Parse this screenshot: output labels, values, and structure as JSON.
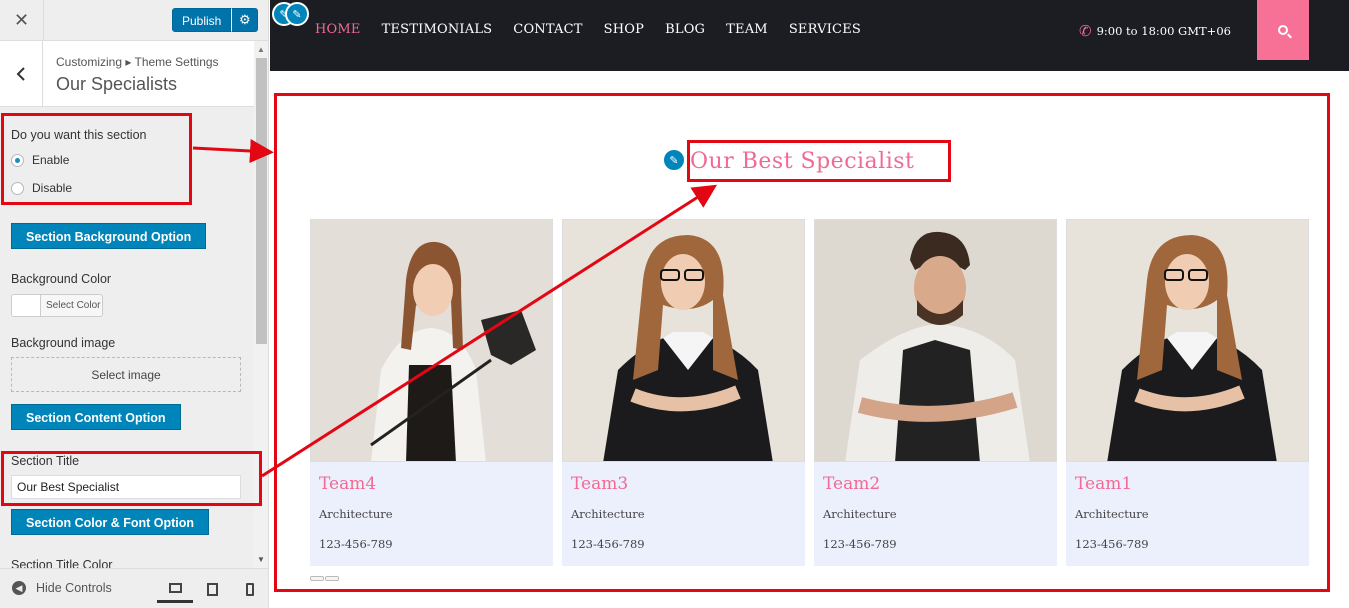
{
  "sidebar": {
    "close_icon": "close-icon",
    "publish_label": "Publish",
    "breadcrumb": "Customizing ▸ Theme Settings",
    "section_title": "Our Specialists",
    "question": "Do you want this section",
    "radio_enable": "Enable",
    "radio_disable": "Disable",
    "bg_option_button": "Section Background Option",
    "bg_color_label": "Background Color",
    "select_color": "Select Color",
    "bg_image_label": "Background image",
    "select_image": "Select image",
    "content_option_button": "Section Content Option",
    "section_title_label": "Section Title",
    "section_title_value": "Our Best Specialist",
    "color_font_button": "Section Color & Font Option",
    "title_color_label": "Section Title Color",
    "hide_controls": "Hide Controls"
  },
  "site": {
    "menu": [
      "HOME",
      "TESTIMONIALS",
      "CONTACT",
      "SHOP",
      "BLOG",
      "TEAM",
      "SERVICES"
    ],
    "hours": "9:00 to 18:00 GMT+06",
    "specialists_title": "Our Best Specialist",
    "team": [
      {
        "name": "Team4",
        "role": "Architecture",
        "phone": "123-456-789"
      },
      {
        "name": "Team3",
        "role": "Architecture",
        "phone": "123-456-789"
      },
      {
        "name": "Team2",
        "role": "Architecture",
        "phone": "123-456-789"
      },
      {
        "name": "Team1",
        "role": "Architecture",
        "phone": "123-456-789"
      }
    ]
  },
  "colors": {
    "accent_pink": "#f06a93",
    "wp_blue": "#0085ba",
    "annotation_red": "#e30613",
    "nav_dark": "#1b1d23"
  }
}
